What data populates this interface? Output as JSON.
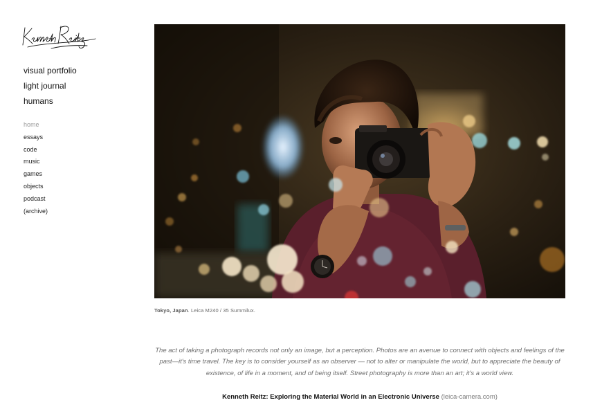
{
  "logo": {
    "text": "Kenneth Reitz"
  },
  "primary_nav": [
    {
      "label": "visual portfolio"
    },
    {
      "label": "light journal"
    },
    {
      "label": "humans"
    }
  ],
  "secondary_nav": [
    {
      "label": "home",
      "state": "muted"
    },
    {
      "label": "essays"
    },
    {
      "label": "code"
    },
    {
      "label": "music"
    },
    {
      "label": "games"
    },
    {
      "label": "objects"
    },
    {
      "label": "podcast"
    },
    {
      "label": "(archive)"
    }
  ],
  "photo": {
    "caption_location": "Tokyo, Japan",
    "caption_rest": ". Leica M240 / 35 Summilux."
  },
  "quote": "The act of taking a photograph records not only an image, but a perception. Photos are an avenue to connect with objects and feelings of the past—it's time travel. The key is to consider yourself as an observer — not to alter or manipulate the world, but to appreciate the beauty of existence, of life in a moment, and of being itself. Street photography is more than an art; it's a world view.",
  "source": {
    "title": "Kenneth Reitz: Exploring the Material World in an Electronic Universe",
    "domain": "(leica-camera.com)"
  },
  "colors": {
    "text": "#111111",
    "muted": "#9a9a9a",
    "quote": "#6d6d6d"
  }
}
